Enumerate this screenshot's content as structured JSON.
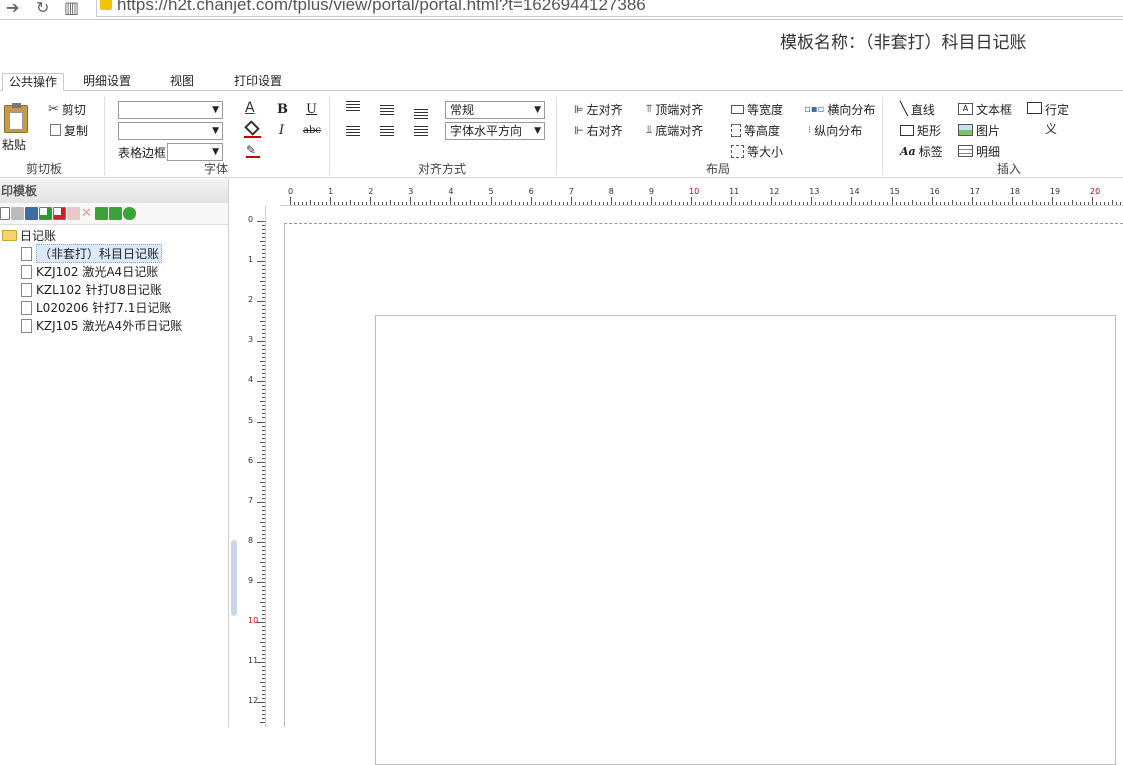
{
  "browser": {
    "url": "https://h2t.chanjet.com/tplus/view/portal/portal.html?t=1626944127386"
  },
  "template_title": "模板名称：（非套打）科目日记账",
  "tabs": [
    {
      "label": "公共操作",
      "active": true
    },
    {
      "label": "明细设置",
      "active": false
    },
    {
      "label": "视图",
      "active": false
    },
    {
      "label": "打印设置",
      "active": false
    }
  ],
  "clipboard": {
    "group_label": "剪切板",
    "paste": "粘贴",
    "cut": "剪切",
    "copy": "复制"
  },
  "font": {
    "group_label": "字体",
    "font_family_value": "",
    "font_size_value": "",
    "table_border_label": "表格边框",
    "table_border_value": "",
    "bold": "B",
    "italic": "I",
    "underline": "U",
    "strike": "abc",
    "font_color": "A"
  },
  "align": {
    "group_label": "对齐方式",
    "style_value": "常规",
    "text_direction_value": "字体水平方向"
  },
  "layout": {
    "group_label": "布局",
    "left_align": "左对齐",
    "right_align": "右对齐",
    "top_align": "顶端对齐",
    "bottom_align": "底端对齐",
    "equal_width": "等宽度",
    "equal_height": "等高度",
    "equal_size": "等大小",
    "h_distribute": "横向分布",
    "v_distribute": "纵向分布"
  },
  "insert": {
    "group_label": "插入",
    "line": "直线",
    "rect": "矩形",
    "label": "标签",
    "textbox": "文本框",
    "image": "图片",
    "detail": "明细",
    "row_def_1": "行定",
    "row_def_2": "义"
  },
  "left_panel": {
    "header": "印模板",
    "tree_root": "日记账",
    "items": [
      {
        "label": "（非套打）科目日记账",
        "selected": true
      },
      {
        "label": "KZJ102 激光A4日记账",
        "selected": false
      },
      {
        "label": "KZL102 针打U8日记账",
        "selected": false
      },
      {
        "label": "L020206 针打7.1日记账",
        "selected": false
      },
      {
        "label": "KZJ105 激光A4外币日记账",
        "selected": false
      }
    ]
  },
  "ruler": {
    "h_ticks": [
      "0",
      "1",
      "2",
      "3",
      "4",
      "5",
      "6",
      "7",
      "8",
      "9",
      "10",
      "11",
      "12",
      "13",
      "14",
      "15",
      "16",
      "17",
      "18",
      "19",
      "20"
    ],
    "v_ticks": [
      "0",
      "1",
      "2",
      "3",
      "4",
      "5",
      "6",
      "7",
      "8",
      "9",
      "10",
      "11",
      "12"
    ],
    "highlight_color": "#cc0000"
  },
  "colors": {
    "accent_red": "#cc0000",
    "selection_blue": "#dbe9f8"
  }
}
